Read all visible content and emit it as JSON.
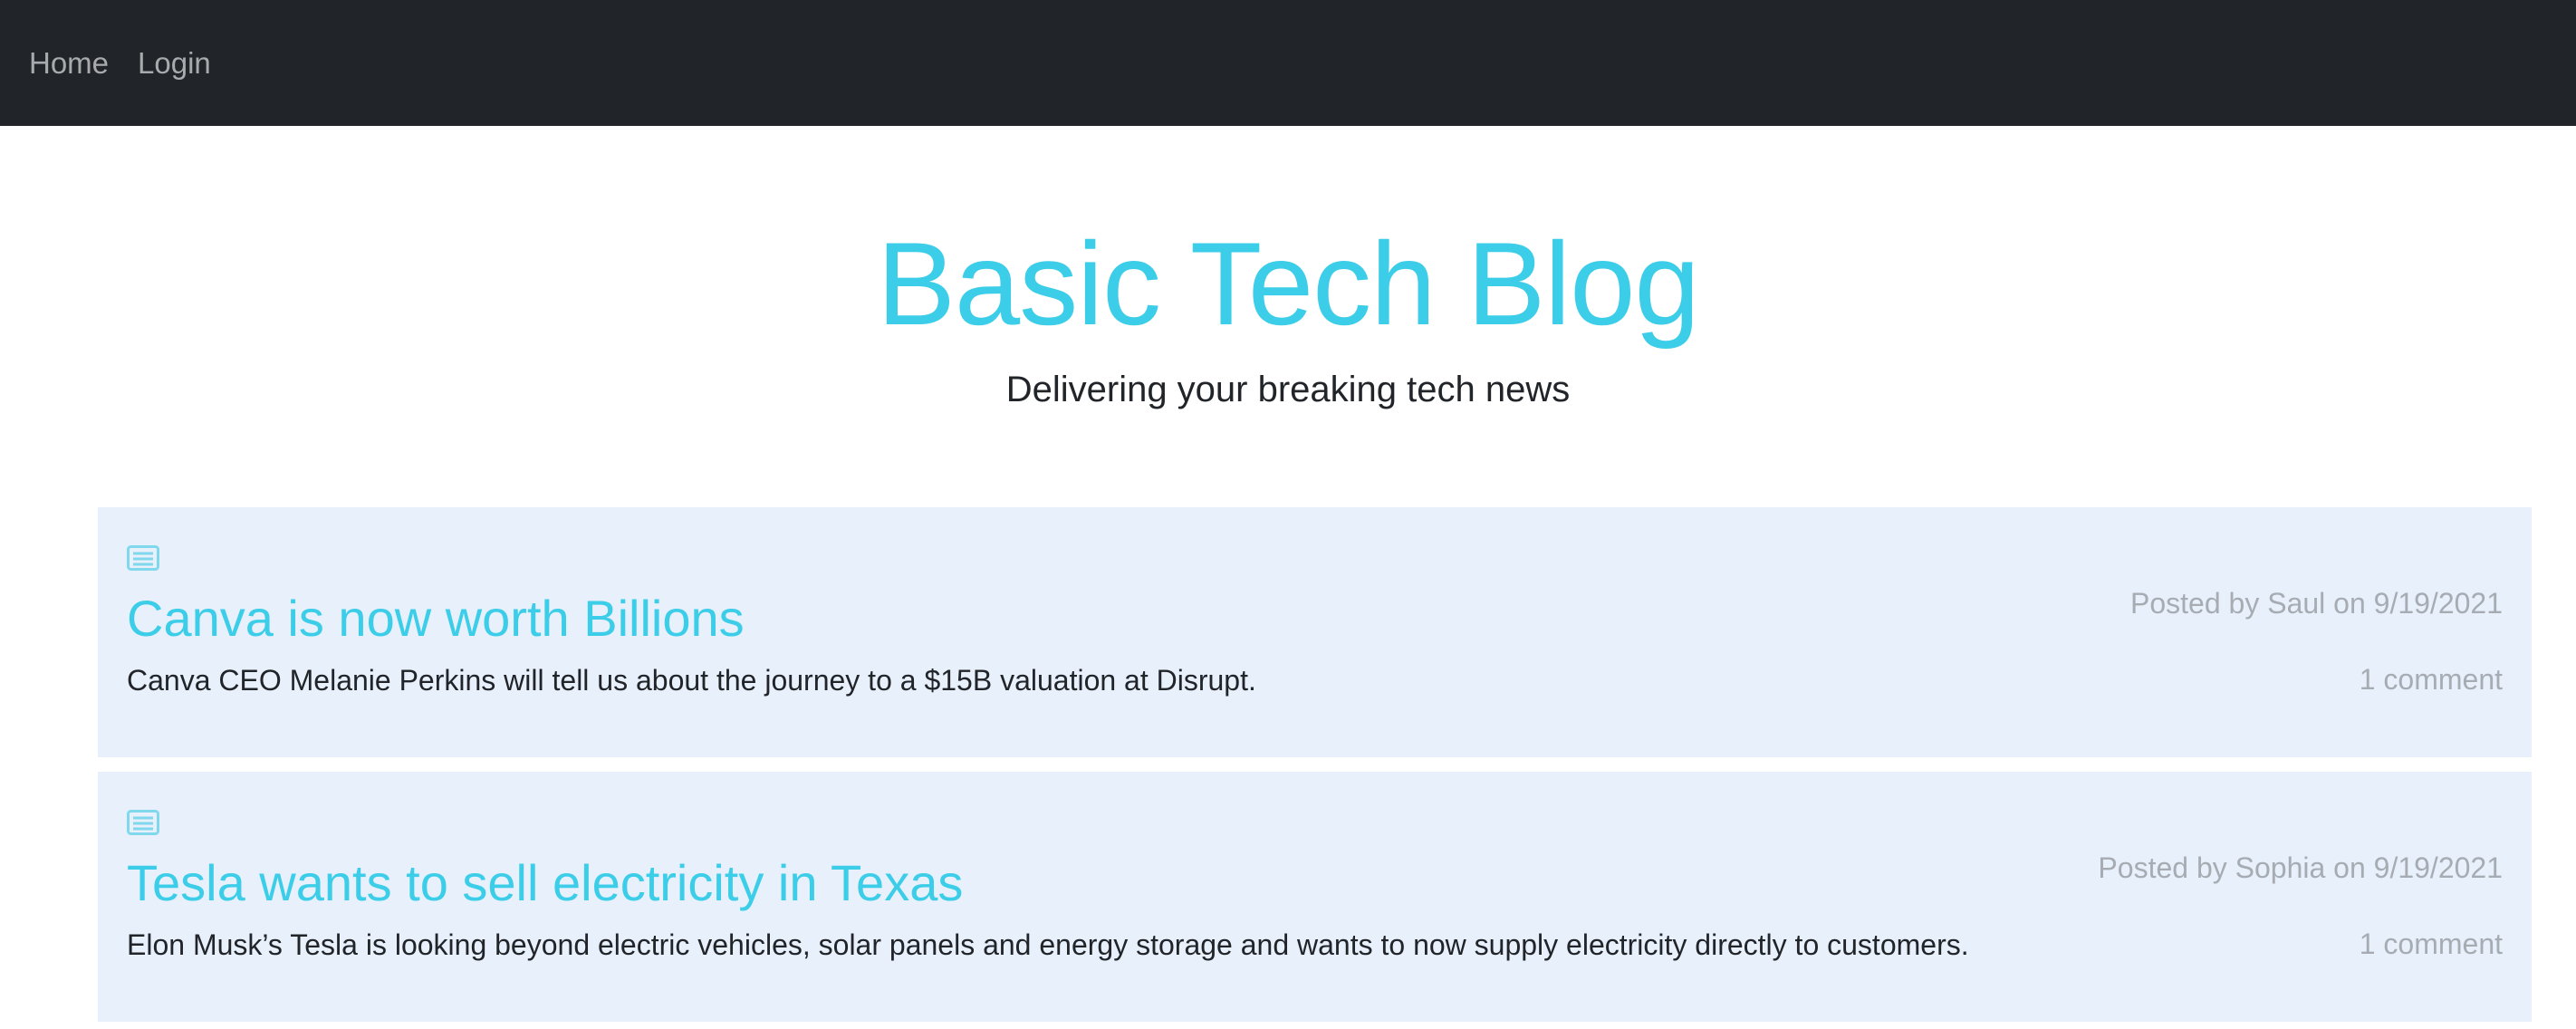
{
  "nav": {
    "home_label": "Home",
    "login_label": "Login"
  },
  "hero": {
    "title": "Basic Tech Blog",
    "subtitle": "Delivering your breaking tech news"
  },
  "posts": [
    {
      "icon": "newspaper-icon",
      "title": "Canva is now worth Billions",
      "body": "Canva CEO Melanie Perkins will tell us about the journey to a $15B valuation at Disrupt.",
      "meta": "Posted by Saul on 9/19/2021",
      "comments": "1 comment"
    },
    {
      "icon": "newspaper-icon",
      "title": "Tesla wants to sell electricity in Texas",
      "body": "Elon Musk’s Tesla is looking beyond electric vehicles, solar panels and energy storage and wants to now supply electricity directly to customers.",
      "meta": "Posted by Sophia on 9/19/2021",
      "comments": "1 comment"
    }
  ],
  "colors": {
    "navbar_bg": "#212529",
    "accent": "#3ccde8",
    "card_bg": "#e8f0fc",
    "muted_text": "#a7acb3"
  }
}
